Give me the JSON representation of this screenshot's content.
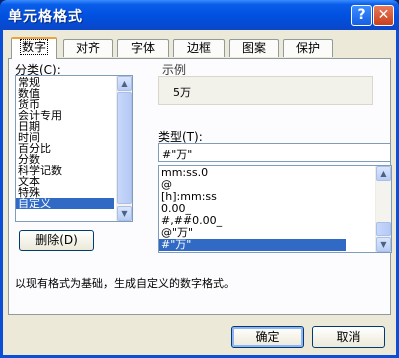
{
  "window": {
    "title": "单元格格式",
    "help_glyph": "?",
    "close_glyph": "✕"
  },
  "tabs": [
    {
      "label": "数字",
      "active": true
    },
    {
      "label": "对齐",
      "active": false
    },
    {
      "label": "字体",
      "active": false
    },
    {
      "label": "边框",
      "active": false
    },
    {
      "label": "图案",
      "active": false
    },
    {
      "label": "保护",
      "active": false
    }
  ],
  "category": {
    "label": "分类(C):",
    "items": [
      "常规",
      "数值",
      "货币",
      "会计专用",
      "日期",
      "时间",
      "百分比",
      "分数",
      "科学记数",
      "文本",
      "特殊",
      "自定义"
    ],
    "selected": "自定义"
  },
  "sample": {
    "label": "示例",
    "value": "5万"
  },
  "type": {
    "label": "类型(T):",
    "value": "#\"万\"",
    "items": [
      "mm:ss.0",
      "@",
      "[h]:mm:ss",
      "0.00_",
      "#,##0.00_",
      "@\"万\"",
      "#\"万\""
    ],
    "selected": "#\"万\""
  },
  "delete_button": "删除(D)",
  "description": "以现有格式为基础，生成自定义的数字格式。",
  "ok_button": "确定",
  "cancel_button": "取消",
  "scroll_icons": {
    "up": "▲",
    "down": "▼"
  }
}
